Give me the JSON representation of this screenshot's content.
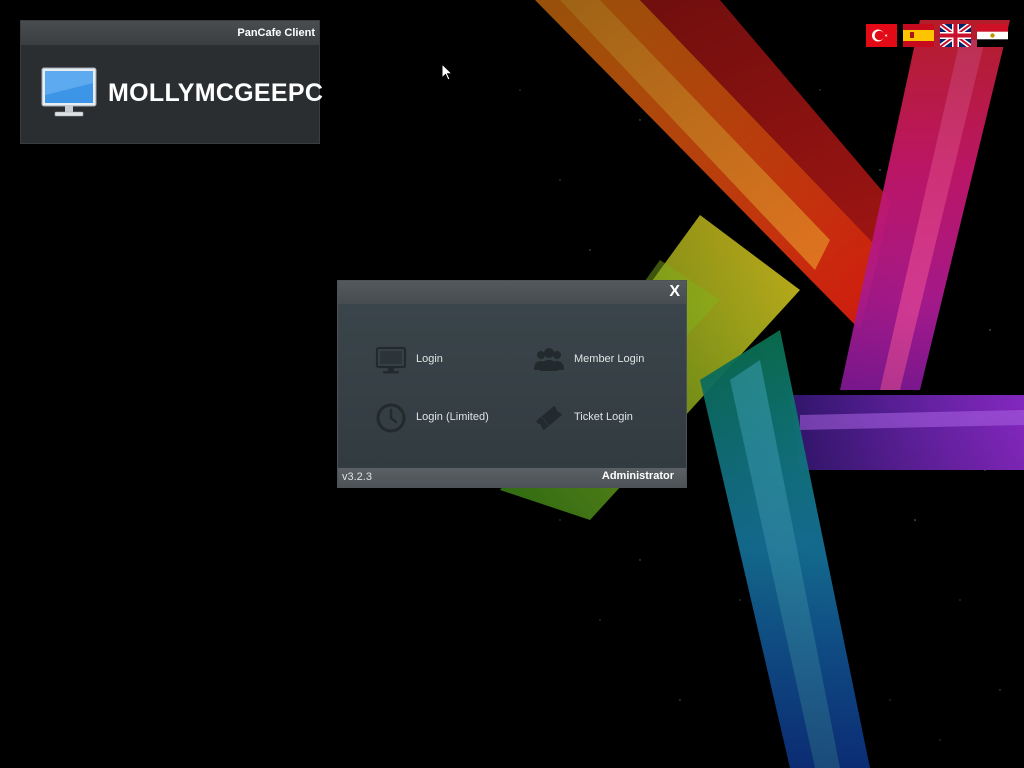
{
  "client_panel": {
    "header_title": "PanCafe Client",
    "computer_name": "MOLLYMCGEEPC",
    "icon": "monitor-icon"
  },
  "language_flags": [
    {
      "name": "turkish-flag",
      "icon": "flag-tr"
    },
    {
      "name": "spanish-flag",
      "icon": "flag-es"
    },
    {
      "name": "english-flag",
      "icon": "flag-uk"
    },
    {
      "name": "arabic-flag",
      "icon": "flag-eg"
    }
  ],
  "login_dialog": {
    "close_label": "X",
    "options": {
      "login": {
        "label": "Login",
        "icon": "monitor-icon"
      },
      "member_login": {
        "label": "Member Login",
        "icon": "users-icon"
      },
      "login_limited": {
        "label": "Login (Limited)",
        "icon": "clock-icon"
      },
      "ticket_login": {
        "label": "Ticket Login",
        "icon": "ticket-icon"
      }
    },
    "version": "v3.2.3",
    "admin_label": "Administrator"
  },
  "colors": {
    "panel_bg": "#2b2e31",
    "dialog_bg": "#323b40",
    "text": "#ffffff"
  }
}
